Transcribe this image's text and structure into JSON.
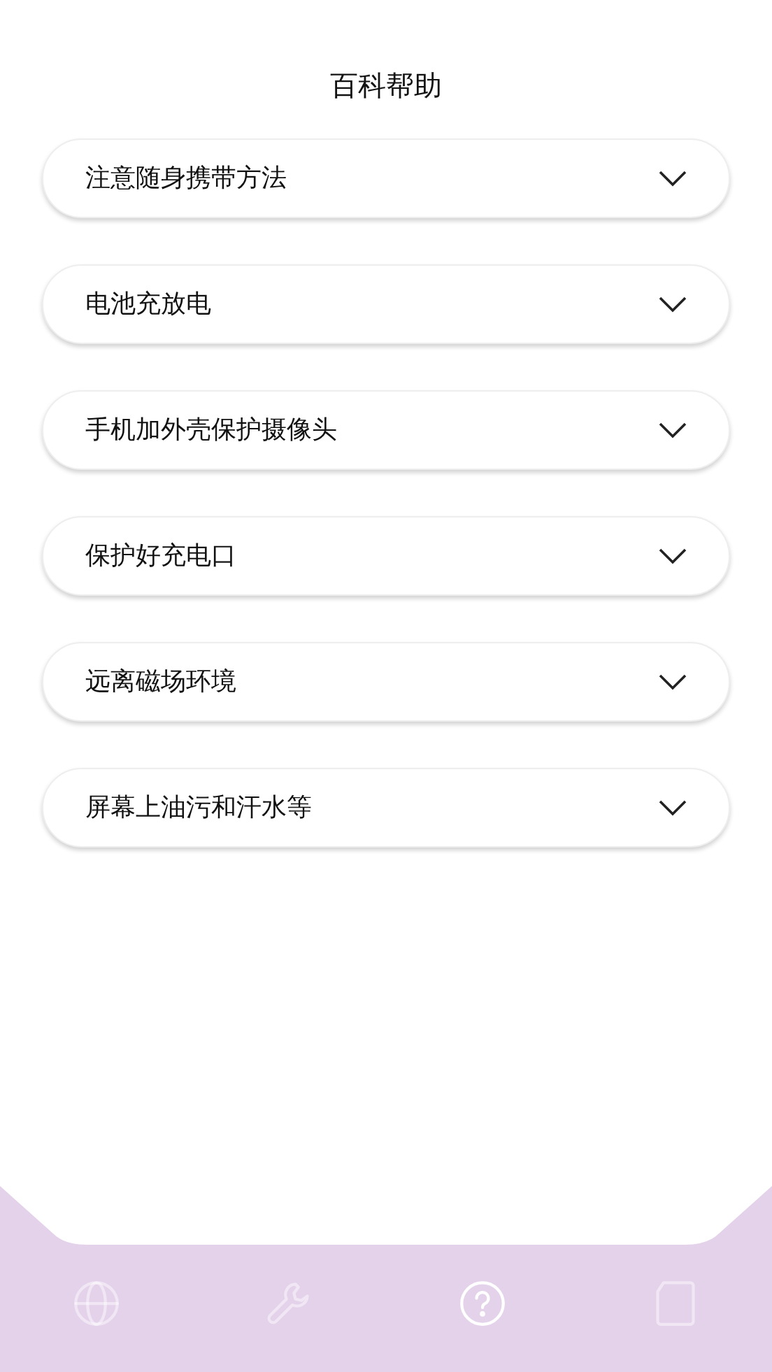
{
  "title": "百科帮助",
  "items": [
    {
      "label": "注意随身携带方法",
      "expanded": false
    },
    {
      "label": "电池充放电",
      "expanded": false
    },
    {
      "label": "手机加外壳保护摄像头",
      "expanded": false
    },
    {
      "label": "保护好充电口",
      "expanded": false
    },
    {
      "label": "远离磁场环境",
      "expanded": false
    },
    {
      "label": "屏幕上油污和汗水等",
      "expanded": false
    }
  ],
  "nav": [
    {
      "kind": "globe",
      "selected": false
    },
    {
      "kind": "wrench",
      "selected": false
    },
    {
      "kind": "help",
      "selected": true
    },
    {
      "kind": "device",
      "selected": false
    }
  ]
}
